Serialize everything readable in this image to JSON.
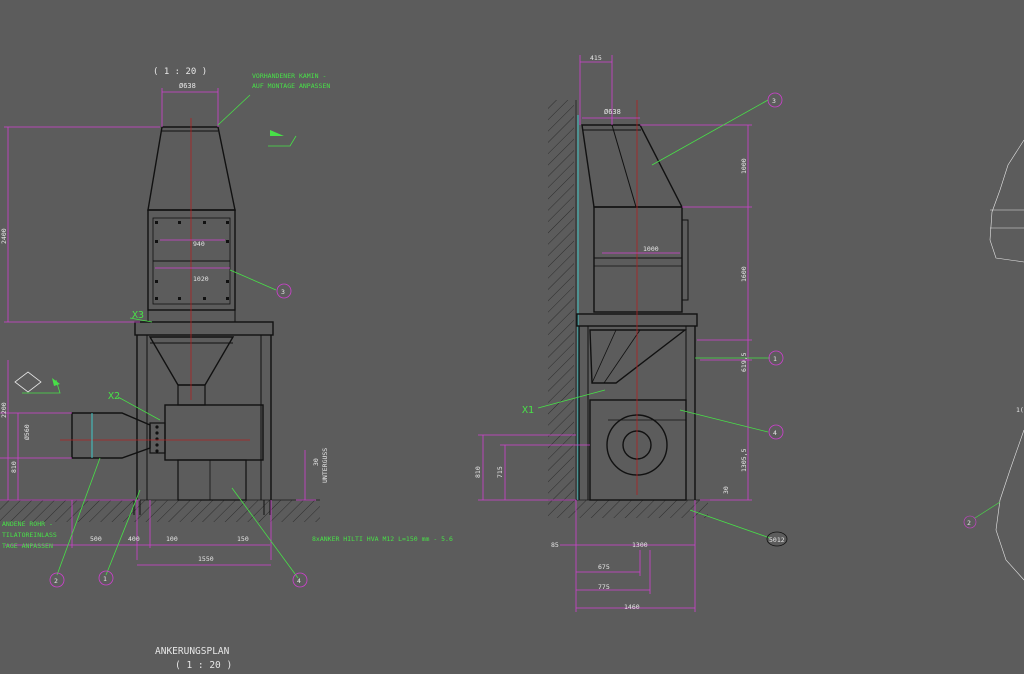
{
  "colors": {
    "background": "#5c5c5c",
    "outline": "#111111",
    "green": "#48e048",
    "magenta": "#d040d0",
    "red": "#b02020",
    "white": "#e6e6e6",
    "cyan": "#40c8c8"
  },
  "front_view": {
    "scale_top": "( 1 : 20 )",
    "chimney_label_1": "VORHANDENER KAMIN -",
    "chimney_label_2": "AUF MONTAGE ANPASSEN",
    "dia_top": "Ø638",
    "height_total": "2400",
    "dim_940": "940",
    "dim_1020": "1020",
    "height_lower": "2200",
    "dia_inlet": "Ø560",
    "dim_810": "810",
    "dim_30": "30",
    "untergus": "UNTERGUSS",
    "anchor_text": "8xANKER HILTI HVA M12 L=150 mm - 5.6",
    "dim_500": "500",
    "dim_400": "400",
    "dim_100": "100",
    "dim_150": "150",
    "dim_1550": "1550",
    "existing_1": "ANDENE ROHR -",
    "existing_2": "TILATOREINLASS",
    "existing_3": "TAGE ANPASSEN",
    "marker_x3": "X3",
    "marker_x2": "X2",
    "balloon_3": "3",
    "balloon_2": "2",
    "balloon_1": "1",
    "balloon_4": "4",
    "anchor_plan_title": "ANKERUNGSPLAN",
    "anchor_plan_scale": "( 1 : 20 )"
  },
  "side_view": {
    "dim_415": "415",
    "dia_top": "Ø638",
    "dim_1000_h": "1000",
    "dim_1000_w": "1000",
    "dim_1600": "1600",
    "dim_619_5": "619,5",
    "dim_1305_5": "1305,5",
    "dim_30": "30",
    "dim_810": "810",
    "dim_715": "715",
    "dim_85": "85",
    "dim_1300": "1300",
    "dim_675": "675",
    "dim_775": "775",
    "dim_1460": "1460",
    "marker_x1": "X1",
    "balloon_3": "3",
    "balloon_1": "1",
    "balloon_4": "4",
    "balloon_5012": "5012"
  },
  "right_fragment": {
    "balloon_2": "2",
    "edge_text": "1("
  }
}
